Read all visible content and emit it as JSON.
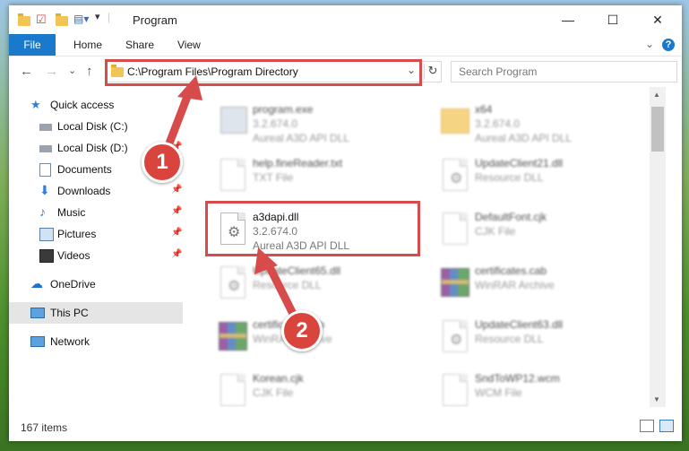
{
  "window": {
    "title": "Program",
    "minimize_glyph": "—",
    "maximize_glyph": "☐",
    "close_glyph": "✕"
  },
  "ribbon": {
    "file_label": "File",
    "home_label": "Home",
    "share_label": "Share",
    "view_label": "View",
    "expand_glyph": "⌄",
    "help_glyph": "?"
  },
  "nav": {
    "back_glyph": "←",
    "forward_glyph": "→",
    "recent_glyph": "⌄",
    "up_glyph": "↑",
    "address": "C:\\Program Files\\Program Directory",
    "address_dropdown_glyph": "⌄",
    "refresh_glyph": "↻",
    "search_placeholder": "Search Program"
  },
  "sidebar": {
    "items": [
      {
        "label": "Quick access",
        "icon": "star-icon"
      },
      {
        "label": "Local Disk (C:)",
        "icon": "drive-icon"
      },
      {
        "label": "Local Disk (D:)",
        "icon": "drive-icon"
      },
      {
        "label": "Documents",
        "icon": "documents-icon"
      },
      {
        "label": "Downloads",
        "icon": "download-icon"
      },
      {
        "label": "Music",
        "icon": "music-icon"
      },
      {
        "label": "Pictures",
        "icon": "pictures-icon"
      },
      {
        "label": "Videos",
        "icon": "videos-icon"
      },
      {
        "label": "OneDrive",
        "icon": "cloud-icon"
      },
      {
        "label": "This PC",
        "icon": "computer-icon"
      },
      {
        "label": "Network",
        "icon": "network-icon"
      }
    ]
  },
  "files": [
    {
      "name": "program.exe",
      "line2": "3.2.674.0",
      "line3": "Aureal A3D API DLL"
    },
    {
      "name": "x64",
      "line2": "3.2.674.0",
      "line3": "Aureal A3D API DLL"
    },
    {
      "name": "help.fineReader.txt",
      "line2": "TXT File"
    },
    {
      "name": "UpdateClient21.dll",
      "line2": "Resource DLL"
    },
    {
      "name": "a3dapi.dll",
      "line2": "3.2.674.0",
      "line3": "Aureal A3D API DLL"
    },
    {
      "name": "DefaultFont.cjk",
      "line2": "CJK File"
    },
    {
      "name": "UpdateClient65.dll",
      "line2": "Resource DLL"
    },
    {
      "name": "certificates.cab",
      "line2": "WinRAR Archive"
    },
    {
      "name": "certificates.cab",
      "line2": "WinRAR Archive"
    },
    {
      "name": "UpdateClient63.dll",
      "line2": "Resource DLL"
    },
    {
      "name": "Korean.cjk",
      "line2": "CJK File"
    },
    {
      "name": "SndToWP12.wcm",
      "line2": "WCM File"
    }
  ],
  "status": {
    "item_count": "167 items"
  },
  "annotations": {
    "step1": "1",
    "step2": "2",
    "highlight_color": "#d74b4b"
  }
}
